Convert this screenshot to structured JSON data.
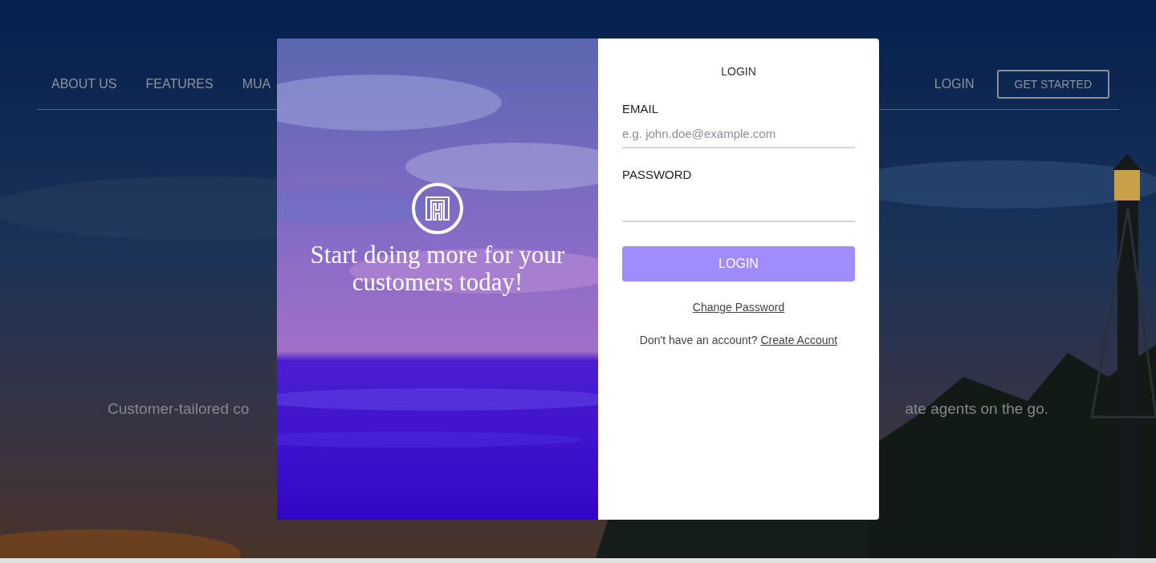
{
  "nav": {
    "items": [
      {
        "label": "ABOUT US"
      },
      {
        "label": "FEATURES"
      },
      {
        "label": "MUA"
      }
    ],
    "login": "LOGIN",
    "get_started": "GET STARTED"
  },
  "tagline_fragments": [
    "Customer-tailored co",
    "ate agents on the go."
  ],
  "modal": {
    "promo_heading": "Start doing more for your customers today!",
    "title": "LOGIN",
    "fields": [
      {
        "label": "EMAIL",
        "placeholder": "e.g. john.doe@example.com",
        "kind": "email"
      },
      {
        "label": "PASSWORD",
        "kind": "password"
      }
    ],
    "submit": "LOGIN",
    "change_password": "Change Password",
    "signup_prompt": "Don't have an account?",
    "signup_link": "Create Account"
  }
}
